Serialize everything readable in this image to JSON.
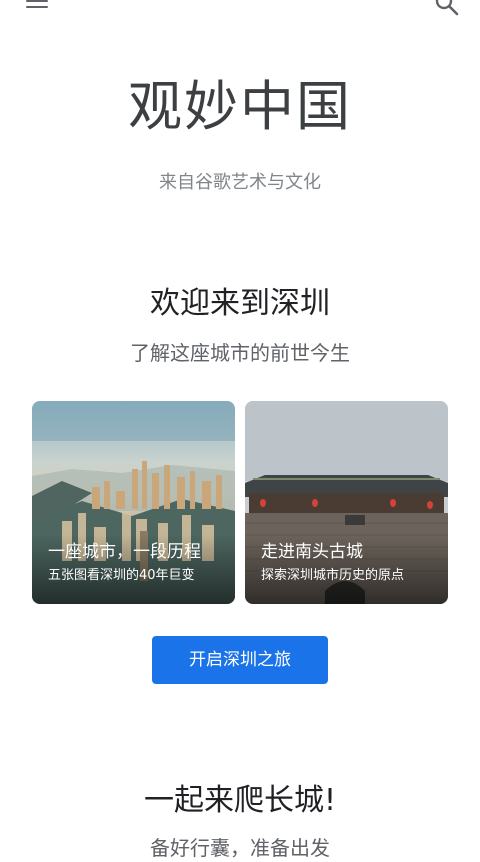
{
  "header": {
    "menu_icon": "hamburger-menu-icon",
    "search_icon": "search-icon"
  },
  "hero": {
    "title": "观妙中国",
    "subtitle": "来自谷歌艺术与文化"
  },
  "shenzhen": {
    "title": "欢迎来到深圳",
    "subtitle": "了解这座城市的前世今生",
    "cards": [
      {
        "title": "一座城市，一段历程",
        "subtitle": "五张图看深圳的40年巨变"
      },
      {
        "title": "走进南头古城",
        "subtitle": "探索深圳城市历史的原点"
      }
    ],
    "cta_label": "开启深圳之旅"
  },
  "great_wall": {
    "title": "一起来爬长城!",
    "subtitle": "备好行囊，准备出发"
  },
  "colors": {
    "accent": "#1a73e8",
    "title_text": "#3c4043",
    "muted_text": "#80868b"
  }
}
